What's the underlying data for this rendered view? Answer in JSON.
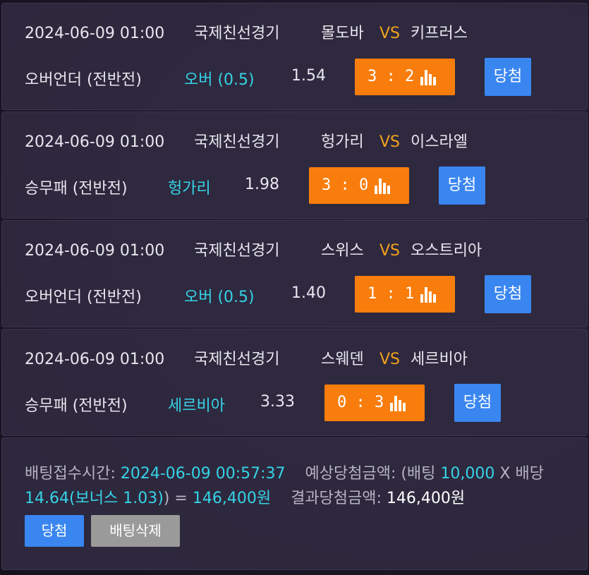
{
  "colors": {
    "accent_orange": "#f87d0c",
    "accent_blue": "#3a86f0",
    "cyan": "#36d3e6",
    "vs": "#f2a21c"
  },
  "bets": [
    {
      "date": "2024-06-09 01:00",
      "league": "국제친선경기",
      "home": "몰도바",
      "vs": "VS",
      "away": "키프러스",
      "market": "오버언더 (전반전)",
      "pick": "오버  (0.5)",
      "odds": "1.54",
      "score": "3 : 2",
      "win_label": "당첨"
    },
    {
      "date": "2024-06-09 01:00",
      "league": "국제친선경기",
      "home": "헝가리",
      "vs": "VS",
      "away": "이스라엘",
      "market": "승무패 (전반전)",
      "pick": "헝가리",
      "odds": "1.98",
      "score": "3 : 0",
      "win_label": "당첨"
    },
    {
      "date": "2024-06-09 01:00",
      "league": "국제친선경기",
      "home": "스위스",
      "vs": "VS",
      "away": "오스트리아",
      "market": "오버언더 (전반전)",
      "pick": "오버  (0.5)",
      "odds": "1.40",
      "score": "1 : 1",
      "win_label": "당첨"
    },
    {
      "date": "2024-06-09 01:00",
      "league": "국제친선경기",
      "home": "스웨덴",
      "vs": "VS",
      "away": "세르비아",
      "market": "승무패 (전반전)",
      "pick": "세르비아",
      "odds": "3.33",
      "score": "0 : 3",
      "win_label": "당첨"
    }
  ],
  "summary": {
    "accept_label": "배팅접수시간: ",
    "accept_time": "2024-06-09  00:57:37",
    "expected_label": "예상당첨금액: (배팅 ",
    "stake": "10,000",
    "x_label": " X 배당 ",
    "odds_total": "14.64(보너스  1.03)",
    "eq": ") = ",
    "expected_amount": "146,400원",
    "result_label": "결과당첨금액: ",
    "result_amount": "146,400원",
    "win_button": "당첨",
    "delete_button": "배팅삭제"
  }
}
